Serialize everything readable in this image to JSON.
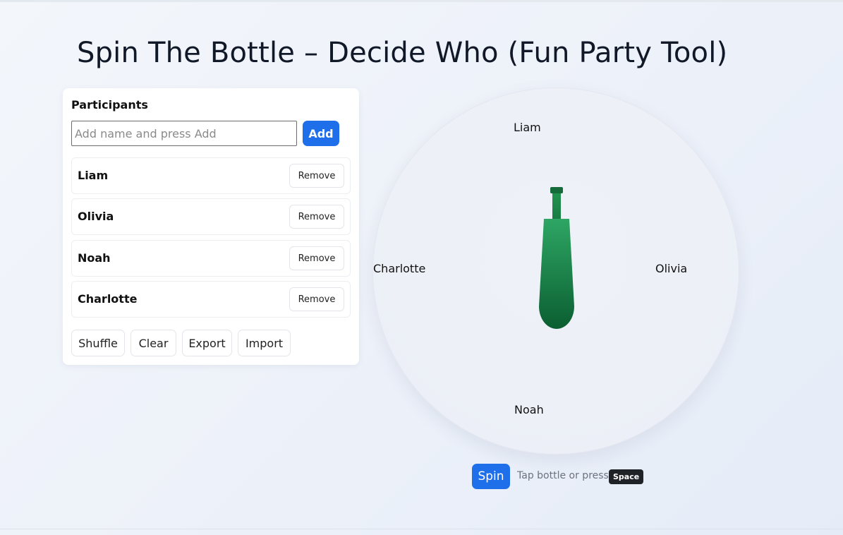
{
  "page": {
    "title": "Spin The Bottle – Decide Who (Fun Party Tool)"
  },
  "participants_panel": {
    "heading": "Participants",
    "input_placeholder": "Add name and press Add",
    "input_value": "",
    "add_label": "Add",
    "remove_label": "Remove",
    "items": [
      {
        "name": "Liam"
      },
      {
        "name": "Olivia"
      },
      {
        "name": "Noah"
      },
      {
        "name": "Charlotte"
      }
    ],
    "actions": {
      "shuffle_label": "Shuffle",
      "clear_label": "Clear",
      "export_label": "Export",
      "import_label": "Import"
    }
  },
  "wheel": {
    "labels": {
      "top": "Liam",
      "right": "Olivia",
      "bottom": "Noah",
      "left": "Charlotte"
    },
    "bottle_icon": "bottle-icon",
    "bottle_colors": {
      "light": "#2ea664",
      "dark": "#0b5e31",
      "cap": "#166b3a"
    }
  },
  "controls": {
    "spin_label": "Spin",
    "hint_text": "Tap bottle or press",
    "key_label": "Space"
  },
  "colors": {
    "accent": "#1f6feb",
    "bottle_green": "#1a8a4b"
  }
}
